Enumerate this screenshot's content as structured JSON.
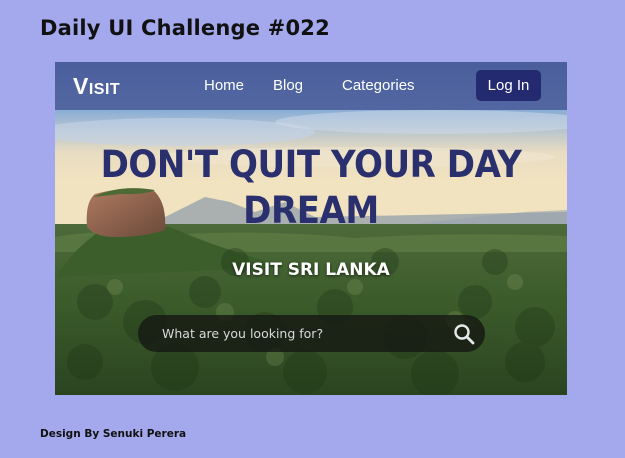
{
  "challenge": {
    "title": "Daily UI Challenge #022"
  },
  "site": {
    "logo_first": "V",
    "logo_rest": "ISIT",
    "nav": {
      "home": "Home",
      "blog": "Blog",
      "categories": "Categories",
      "login": "Log In"
    },
    "hero": {
      "title_line1": "DON'T QUIT YOUR DAY",
      "title_line2": "DREAM",
      "subtitle": "VISIT SRI LANKA"
    },
    "search": {
      "placeholder": "What are you looking for?",
      "value": "",
      "icon": "search-icon"
    }
  },
  "footer": {
    "credit": "Design By Senuki Perera"
  },
  "colors": {
    "page_background": "#a3a9ec",
    "navbar": "#4658a0",
    "login_button": "#232a6f",
    "hero_title": "#2a2f6e"
  }
}
